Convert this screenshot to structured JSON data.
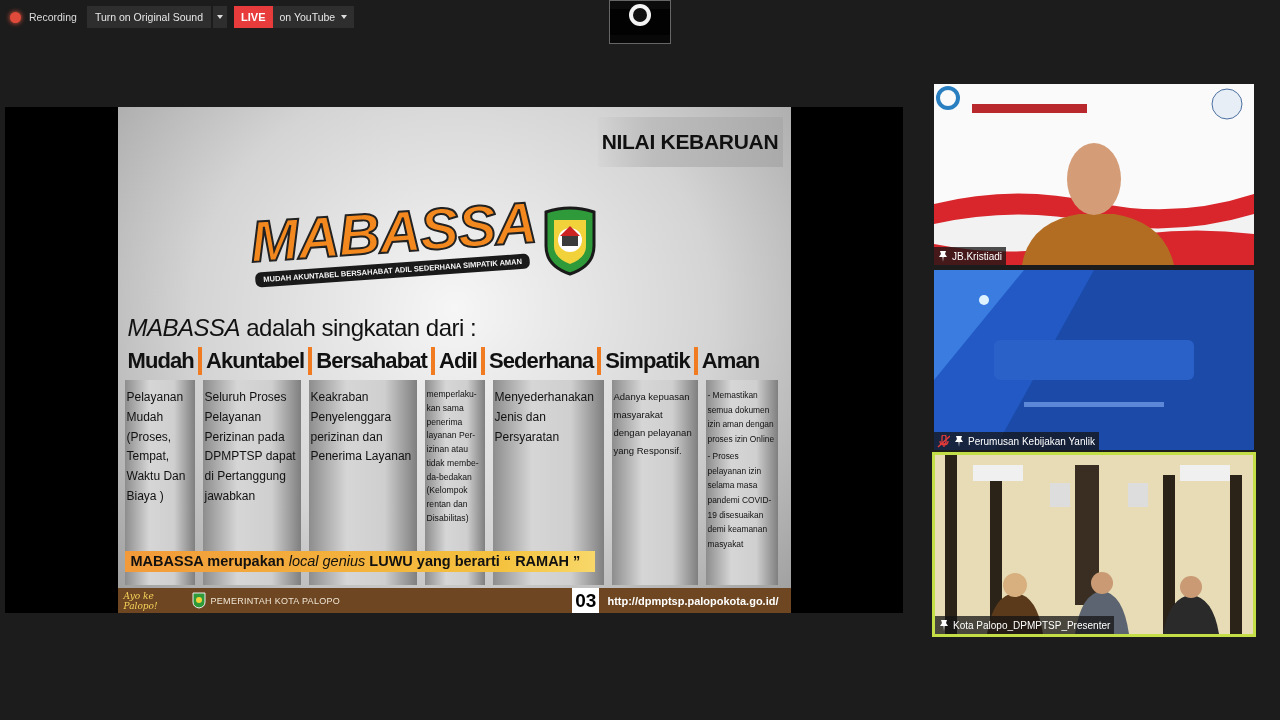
{
  "top_bar": {
    "recording_label": "Recording",
    "original_sound_button": "Turn on Original Sound",
    "live_badge": "LIVE",
    "live_target": "on YouTube"
  },
  "slide": {
    "badge": "NILAI KEBARUAN",
    "logo_title": "MABASSA",
    "logo_tagline": "MUDAH AKUNTABEL BERSAHABAT ADIL SEDERHANA SIMPATIK AMAN",
    "heading": "*MABASSA* adalah singkatan dari :",
    "values": [
      {
        "word": "Mudah",
        "description": [
          "Pelayanan Mudah (Proses, Tempat, Waktu Dan Biaya )"
        ]
      },
      {
        "word": "Akuntabel",
        "description": [
          "Seluruh Proses Pelayanan Perizinan pada DPMPTSP dapat di Pertanggung jawabkan"
        ]
      },
      {
        "word": "Bersahabat",
        "description": [
          "Keakraban Penyelenggara perizinan dan Penerima Layanan"
        ]
      },
      {
        "word": "Adil",
        "description": [
          "memperlaku-kan sama penerima layanan Per-izinan atau tidak membe-da-bedakan (Kelompok rentan dan Disabilitas)"
        ]
      },
      {
        "word": "Sederhana",
        "description": [
          "Menyederhanakan Jenis dan Persyaratan"
        ]
      },
      {
        "word": "Simpatik",
        "description": [
          "Adanya kepuasan masyarakat dengan pelayanan yang Responsif."
        ]
      },
      {
        "word": "Aman",
        "description": [
          "- Memastikan semua dokumen izin aman dengan proses izin Online",
          "- Proses pelayanan izin selama masa pandemi COVID-19 disesuaikan demi keamanan masyakat"
        ]
      }
    ],
    "banner": "MABASSA merupakan *local genius* LUWU yang berarti “ RAMAH ”",
    "footer": {
      "slogan": "Ayo ke Palopo!",
      "government": "PEMERINTAH KOTA PALOPO",
      "page_number": "03",
      "url": "http://dpmptsp.palopokota.go.id/"
    }
  },
  "participants": [
    {
      "name": "JB.Kristiadi",
      "muted": false,
      "active": false,
      "kind": "picture"
    },
    {
      "name": "Perumusan Kebijakan Yanlik",
      "muted": true,
      "active": false,
      "kind": "picture"
    },
    {
      "name": "Kota Palopo_DPMPTSP_Presenter",
      "muted": false,
      "active": true,
      "kind": "picture"
    }
  ]
}
